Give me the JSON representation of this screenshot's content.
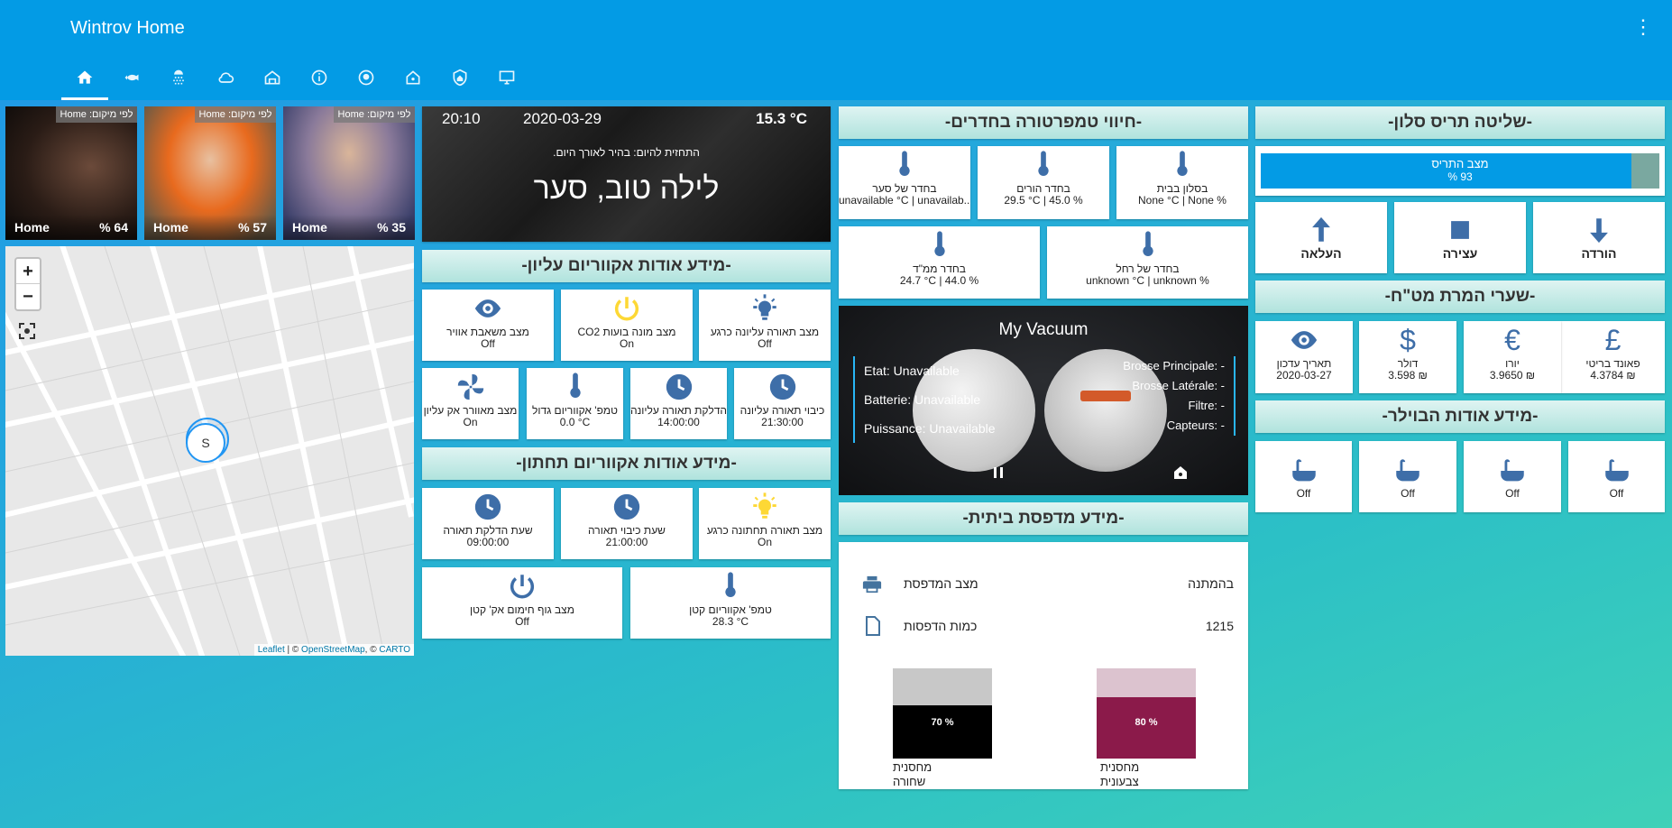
{
  "app": {
    "title": "Wintrov Home"
  },
  "persons": [
    {
      "label": "לפי מיקום: Home",
      "state": "Home",
      "battery": "% 64"
    },
    {
      "label": "לפי מיקום: Home",
      "state": "Home",
      "battery": "% 57"
    },
    {
      "label": "לפי מיקום: Home",
      "state": "Home",
      "battery": "% 35"
    }
  ],
  "map": {
    "marker": "S",
    "attr_leaflet": "Leaflet",
    "attr_rest": " | © ",
    "attr_osm": "OpenStreetMap",
    "attr_sep": ", © ",
    "attr_carto": "CARTO"
  },
  "greeting": {
    "time": "20:10",
    "date": "2020-03-29",
    "temp": "15.3 °C",
    "forecast": "התחזית להיום: בהיר לאורך היום.",
    "text": "לילה טוב, סער"
  },
  "upper_aquarium": {
    "title": "-מידע אודות אקווריום עליון-",
    "row1": [
      {
        "name": "מצב תאורה עליונה כרגע",
        "state": "Off",
        "icon": "bulb-icon"
      },
      {
        "name": "מצב מונה בועות CO2",
        "state": "On",
        "icon": "power-icon"
      },
      {
        "name": "מצב משאבת אוויר",
        "state": "Off",
        "icon": "eye-icon"
      }
    ],
    "row2": [
      {
        "name": "כיבוי תאורה עליונה",
        "state": "21:30:00",
        "icon": "clock-icon"
      },
      {
        "name": "הדלקת תאורה עליונה",
        "state": "14:00:00",
        "icon": "clock-icon"
      },
      {
        "name": "טמפ' אקווריום גדול",
        "state": "0.0 °C",
        "icon": "thermometer-icon"
      },
      {
        "name": "מצב מאוורר אק עליון",
        "state": "On",
        "icon": "fan-icon"
      }
    ]
  },
  "lower_aquarium": {
    "title": "-מידע אודות אקווריום תחתון-",
    "row1": [
      {
        "name": "מצב תאורה תחתונה כרגע",
        "state": "On",
        "icon": "bulb-icon"
      },
      {
        "name": "שעת כיבוי תאורה",
        "state": "21:00:00",
        "icon": "clock-icon"
      },
      {
        "name": "שעת הדלקת תאורה",
        "state": "09:00:00",
        "icon": "clock-icon"
      }
    ],
    "row2": [
      {
        "name": "טמפ' אקווריום קטן",
        "state": "28.3 °C",
        "icon": "thermometer-icon"
      },
      {
        "name": "מצב גוף חימום אק' קטן",
        "state": "Off",
        "icon": "power-icon"
      }
    ]
  },
  "rooms": {
    "title": "-חיווי טמפרטורה בחדרים-",
    "row1": [
      {
        "name": "בסלון בבית",
        "state": "None °C | None %"
      },
      {
        "name": "בחדר הורים",
        "state": "29.5 °C | 45.0 %"
      },
      {
        "name": "בחדר של סער",
        "state": "unavailable °C | unavailab..."
      }
    ],
    "row2": [
      {
        "name": "בחדר של רחל",
        "state": "unknown °C | unknown %"
      },
      {
        "name": "בחדר ממ\"ד",
        "state": "24.7 °C | 44.0 %"
      }
    ]
  },
  "vacuum": {
    "title": "My Vacuum",
    "left": [
      "Etat: Unavailable",
      "Batterie: Unavailable",
      "Puissance: Unavailable"
    ],
    "right": [
      "Brosse Principale: -",
      "Brosse Latérale: -",
      "Filtre: -",
      "Capteurs: -"
    ]
  },
  "printer": {
    "title": "-מידע מדפסת ביתית-",
    "status_label": "מצב המדפסת",
    "status_value": "בהמתנה",
    "count_label": "כמות הדפסות",
    "count_value": "1215",
    "black": {
      "pct": "70 %",
      "level": 0.7,
      "label1": "מחסנית",
      "label2": "שחורה",
      "color": "#000000"
    },
    "color": {
      "pct": "80 %",
      "level": 0.8,
      "label1": "מחסנית",
      "label2": "צבעונית",
      "color": "#8b1a4a"
    }
  },
  "blinds": {
    "title": "-שליטה תריס סלון-",
    "bar_label": "מצב התריס",
    "bar_value": "93 %",
    "position": 0.93,
    "buttons": [
      {
        "label": "הורדה",
        "icon": "arrow-down-icon"
      },
      {
        "label": "עצירה",
        "icon": "stop-icon"
      },
      {
        "label": "העלאה",
        "icon": "arrow-up-icon"
      }
    ]
  },
  "currency": {
    "title": "-שערי המרת מט\"ח-",
    "items": [
      {
        "name": "פאונד בריטי",
        "value": "4.3784 ₪",
        "icon": "pound-icon"
      },
      {
        "name": "יורו",
        "value": "3.9650 ₪",
        "icon": "euro-icon"
      },
      {
        "name": "דולר",
        "value": "3.598 ₪",
        "icon": "dollar-icon"
      },
      {
        "name": "תאריך עדכון",
        "value": "2020-03-27",
        "icon": "eye-icon"
      }
    ]
  },
  "boiler": {
    "title": "-מידע אודות הבוילר-",
    "items": [
      "Off",
      "Off",
      "Off",
      "Off"
    ]
  },
  "colors": {
    "accent": "#039be5",
    "icon": "#3e6ea8",
    "yellow": "#fdd835"
  }
}
